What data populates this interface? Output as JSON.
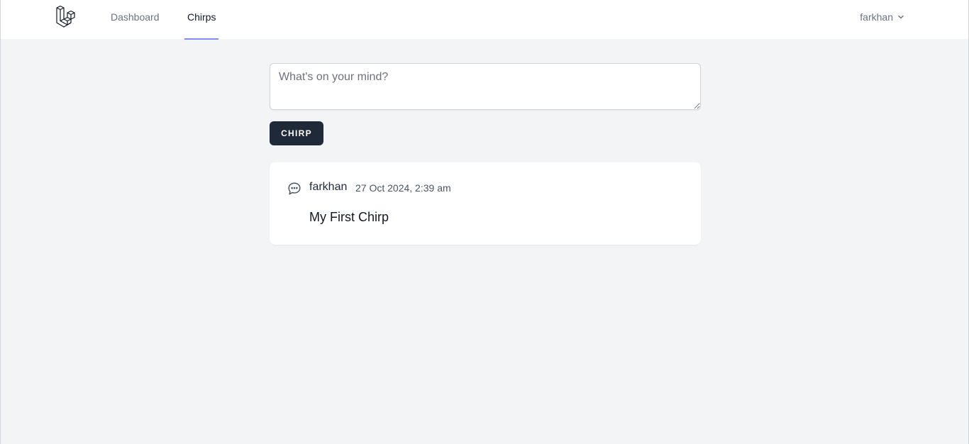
{
  "nav": {
    "links": [
      {
        "label": "Dashboard",
        "active": false
      },
      {
        "label": "Chirps",
        "active": true
      }
    ],
    "user": {
      "name": "farkhan"
    }
  },
  "composer": {
    "placeholder": "What's on your mind?",
    "value": ""
  },
  "submit": {
    "label": "CHIRP"
  },
  "chirps": [
    {
      "author": "farkhan",
      "timestamp": "27 Oct 2024, 2:39 am",
      "message": "My First Chirp"
    }
  ],
  "colors": {
    "accent": "#818cf8",
    "button_bg": "#1f2937",
    "page_bg": "#f3f4f6"
  },
  "icons": {
    "logo": "laravel-logo-icon",
    "user_menu": "chevron-down-icon",
    "chirp": "chat-bubble-icon"
  }
}
